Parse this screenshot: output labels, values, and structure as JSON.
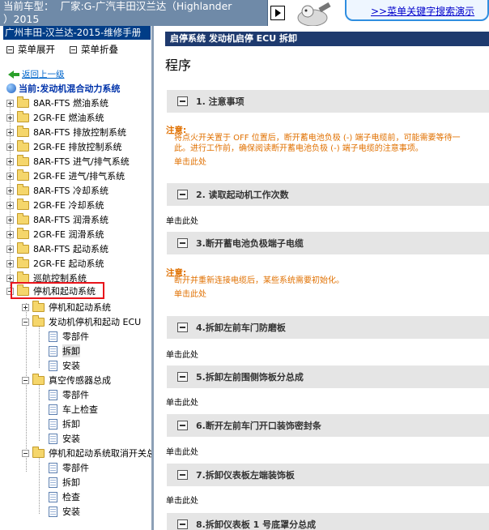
{
  "header": {
    "model_line1": "当前车型：  厂家:G-广汽丰田汉兰达（Highlander",
    "model_line2": "）2015",
    "search_link": ">>菜单关键字搜索演示"
  },
  "sidebar": {
    "manual_title": "广州丰田-汉兰达-2015-维修手册",
    "expand_label": "菜单展开",
    "collapse_label": "菜单折叠",
    "back_label": "返回上一级",
    "current_label": "当前:发动机混合动力系统",
    "systems": [
      "8AR-FTS 燃油系统",
      "2GR-FE 燃油系统",
      "8AR-FTS 排放控制系统",
      "2GR-FE 排放控制系统",
      "8AR-FTS 进气/排气系统",
      "2GR-FE 进气/排气系统",
      "8AR-FTS 冷却系统",
      "2GR-FE 冷却系统",
      "8AR-FTS 润滑系统",
      "2GR-FE 润滑系统",
      "8AR-FTS 起动系统",
      "2GR-FE 起动系统",
      "巡航控制系统",
      "停机和起动系统"
    ],
    "sub_items": [
      "停机和起动系统",
      "发动机停机和起动 ECU",
      "零部件",
      "拆卸",
      "安装",
      "真空传感器总成",
      "零部件",
      "车上检查",
      "拆卸",
      "安装",
      "停机和起动系统取消开关总成",
      "零部件",
      "拆卸",
      "检查",
      "安装"
    ]
  },
  "content": {
    "breadcrumb": "启停系统  发动机启停 ECU  拆卸",
    "title": "程序",
    "steps": [
      "1. 注意事项",
      "2. 读取起动机工作次数",
      "3.断开蓄电池负极端子电缆",
      "4.拆卸左前车门防磨板",
      "5.拆卸左前围侧饰板分总成",
      "6.断开左前车门开口装饰密封条",
      "7.拆卸仪表板左端装饰板",
      "8.拆卸仪表板 1 号底罩分总成"
    ],
    "note_label": "注意:",
    "note1_line1": "将点火开关置于 OFF 位置后，断开蓄电池负极 (-) 端子电缆前，可能需要等待一",
    "note1_line2": "此。进行工作前，确保阅读断开蓄电池负极 (-) 端子电缆的注意事项。",
    "note2_line1": "断开并重新连接电缆后，某些系统需要初始化。",
    "click_here": "单击此处"
  },
  "colors": {
    "model_bar": "#6f8aa8",
    "manual_title_bg": "#003d87",
    "breadcrumb_bg": "#1e3a6e",
    "note_orange": "#e07000",
    "highlight_red": "#e8141b"
  }
}
